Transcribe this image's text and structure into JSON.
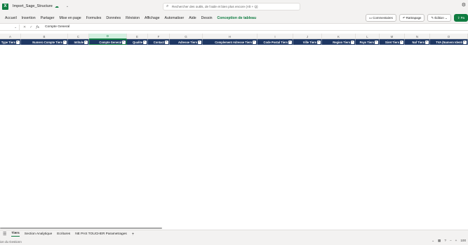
{
  "app": {
    "doc_title": "Import_Sage_Structure",
    "search_placeholder": "Rechercher des outils, de l'aide et bien plus encore (Alt + Q)"
  },
  "menu": {
    "items": [
      "Accueil",
      "Insertion",
      "Partager",
      "Mise en page",
      "Formules",
      "Données",
      "Révision",
      "Affichage",
      "Automatiser",
      "Aide",
      "Dessin",
      "Conception de tableau"
    ],
    "active_index": 11,
    "comments_label": "Commentaires",
    "catchup_label": "Rattrapage",
    "editing_label": "Édition",
    "share_label": "Pa"
  },
  "formula_bar": {
    "fx": "fx",
    "value": "Compte General"
  },
  "columns": {
    "letters": [
      "A",
      "B",
      "C",
      "D",
      "E",
      "F",
      "G",
      "H",
      "I",
      "J",
      "K",
      "L",
      "M",
      "N",
      "O"
    ],
    "selected_index": 3,
    "headers": [
      "Type Tiers",
      "Numero Compte Tiers",
      "Intitule",
      "Compte General",
      "Qualite",
      "Contact",
      "Adresse Tiers",
      "Complement Adresse Tiers",
      "Code Postal Tiers",
      "Ville Tiers",
      "Region Tiers",
      "Pays Tiers",
      "Siret Tiers",
      "Naf Tiers",
      "TVA (Numero Identi"
    ]
  },
  "sheets": {
    "tabs": [
      "Tiers",
      "Section Analytique",
      "Ecritures",
      "NE PAS TOUCHER Parametrages"
    ],
    "active_index": 0
  },
  "status": {
    "left_text": "ion du Gestionn",
    "zoom": "100"
  },
  "colors": {
    "accent": "#107c41",
    "header_fill": "#1f3864"
  }
}
